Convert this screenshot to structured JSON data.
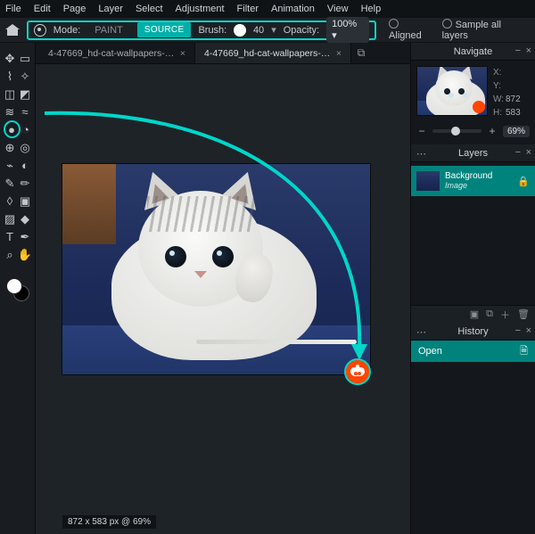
{
  "menu": {
    "items": [
      "File",
      "Edit",
      "Page",
      "Layer",
      "Select",
      "Adjustment",
      "Filter",
      "Animation",
      "View",
      "Help"
    ]
  },
  "toolbar": {
    "mode_label": "Mode:",
    "paint_label": "PAINT",
    "source_label": "SOURCE",
    "brush_label": "Brush:",
    "brush_size": "40",
    "opacity_label": "Opacity:",
    "opacity_value": "100% ▾",
    "aligned_label": "Aligned",
    "sample_label": "Sample all layers"
  },
  "tabs": {
    "items": [
      {
        "label": "4-47669_hd-cat-wallpapers-p...",
        "active": false
      },
      {
        "label": "4-47669_hd-cat-wallpapers-pussycat-i...",
        "active": true
      }
    ]
  },
  "canvas": {
    "status": "872 x 583 px @ 69%"
  },
  "navigate": {
    "title": "Navigate",
    "x_label": "X:",
    "y_label": "Y:",
    "w_label": "W:",
    "w_value": "872",
    "h_label": "H:",
    "h_value": "583",
    "zoom_value": "69%",
    "minus": "−",
    "plus": "+"
  },
  "layers": {
    "title": "Layers",
    "items": [
      {
        "name": "Background",
        "kind": "Image"
      }
    ]
  },
  "history": {
    "title": "History",
    "items": [
      {
        "label": "Open"
      }
    ]
  },
  "colors": {
    "accent": "#00d6c9",
    "teal": "#00837d"
  }
}
